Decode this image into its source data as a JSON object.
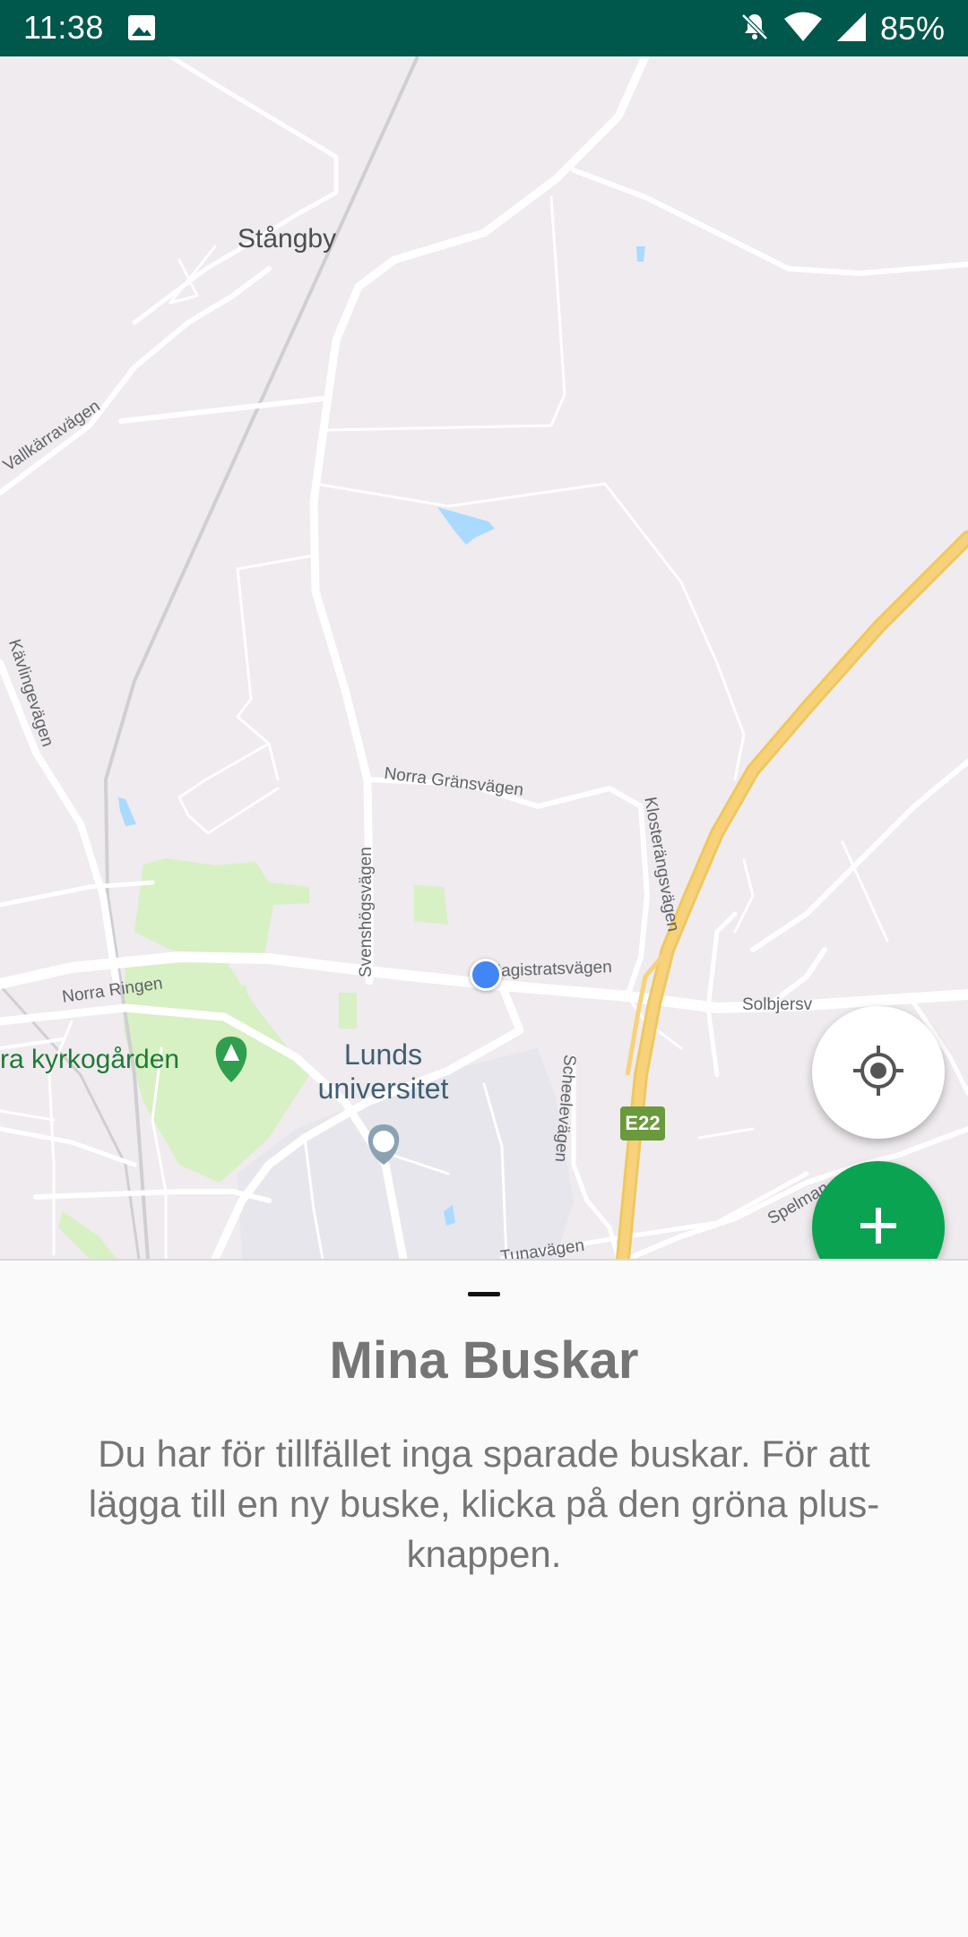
{
  "status_bar": {
    "time": "11:38",
    "battery": "85%",
    "icons": [
      "gallery-icon",
      "notifications-off-icon",
      "wifi-icon",
      "signal-icon",
      "battery-icon"
    ]
  },
  "map": {
    "places": {
      "stangby": "Stångby",
      "university": "Lunds universitet",
      "cemetery": "ra kyrkogården"
    },
    "roads": {
      "vallkarravagen": "Vallkärravägen",
      "kavlingevagen": "Kävlingevägen",
      "norra_gransvagen": "Norra Gränsvägen",
      "klosterangsvagen": "Klosterängsvägen",
      "svenshogsvagen": "Svenshögsvägen",
      "norra_ringen": "Norra Ringen",
      "magistratsvagen": "Magistratsvägen",
      "solbjersv": "Solbjersv",
      "scheelevagen": "Scheelevägen",
      "tunavagen": "Tunavägen",
      "spelman": "Spelman"
    },
    "highway_shield": "E22",
    "colors": {
      "land": "#efebee",
      "road": "#ffffff",
      "highway": "#f7d27a",
      "park": "#d7f0c4",
      "water": "#aadaff",
      "location_dot": "#4285f4"
    }
  },
  "buttons": {
    "my_location_icon": "my-location-icon",
    "add_icon": "plus-icon",
    "add_color": "#0aa351"
  },
  "sheet": {
    "title": "Mina Buskar",
    "body": "Du har för tillfället inga sparade buskar. För att lägga till en ny buske, klicka på den gröna plus-knappen."
  }
}
